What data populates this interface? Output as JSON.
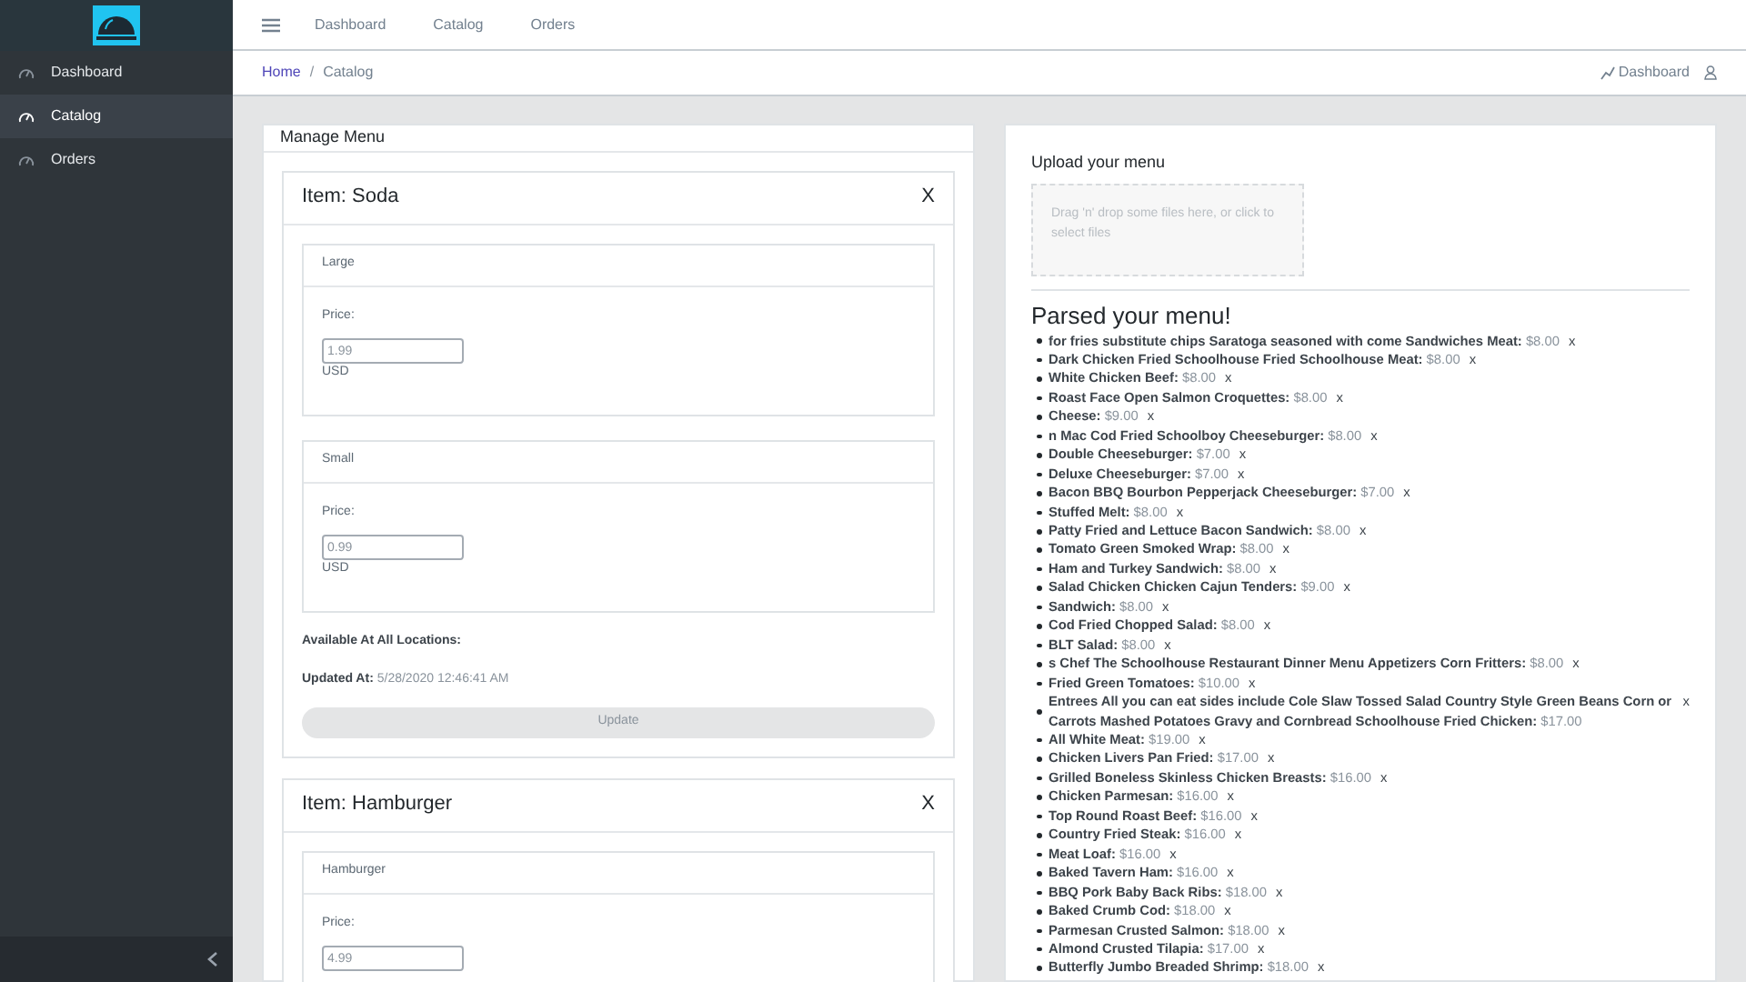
{
  "sidebar": {
    "items": [
      {
        "label": "Dashboard",
        "selected": false
      },
      {
        "label": "Catalog",
        "selected": true
      },
      {
        "label": "Orders",
        "selected": false
      }
    ]
  },
  "top_nav": [
    "Dashboard",
    "Catalog",
    "Orders"
  ],
  "breadcrumb": {
    "items": [
      "Home",
      "Catalog"
    ],
    "separator": "/"
  },
  "header_right": {
    "link": "Dashboard"
  },
  "manage_menu": {
    "title": "Manage Menu",
    "items": [
      {
        "title": "Item: Soda",
        "close": "X",
        "variants": [
          {
            "name": "Large",
            "price_label": "Price:",
            "price": "1.99",
            "currency": "USD"
          },
          {
            "name": "Small",
            "price_label": "Price:",
            "price": "0.99",
            "currency": "USD"
          }
        ],
        "available_label": "Available At All Locations:",
        "updated_label": "Updated At:",
        "updated_value": "5/28/2020 12:46:41 AM",
        "button": "Update"
      },
      {
        "title": "Item: Hamburger",
        "close": "X",
        "variants": [
          {
            "name": "Hamburger",
            "price_label": "Price:",
            "price": "4.99"
          }
        ]
      }
    ]
  },
  "upload": {
    "title": "Upload your menu",
    "dropzone": "Drag 'n' drop some files here, or click to select files"
  },
  "parsed": {
    "title": "Parsed your menu!",
    "items": [
      {
        "name": "for fries substitute chips Saratoga seasoned with come Sandwiches Meat:",
        "price": "$8.00",
        "remove": "x"
      },
      {
        "name": "Dark Chicken Fried Schoolhouse Fried Schoolhouse Meat:",
        "price": "$8.00",
        "remove": "x"
      },
      {
        "name": "White Chicken Beef:",
        "price": "$8.00",
        "remove": "x"
      },
      {
        "name": "Roast Face Open Salmon Croquettes:",
        "price": "$8.00",
        "remove": "x"
      },
      {
        "name": "Cheese:",
        "price": "$9.00",
        "remove": "x"
      },
      {
        "name": "n Mac Cod Fried Schoolboy Cheeseburger:",
        "price": "$8.00",
        "remove": "x"
      },
      {
        "name": "Double Cheeseburger:",
        "price": "$7.00",
        "remove": "x"
      },
      {
        "name": "Deluxe Cheeseburger:",
        "price": "$7.00",
        "remove": "x"
      },
      {
        "name": "Bacon BBQ Bourbon Pepperjack Cheeseburger:",
        "price": "$7.00",
        "remove": "x"
      },
      {
        "name": "Stuffed Melt:",
        "price": "$8.00",
        "remove": "x"
      },
      {
        "name": "Patty Fried and Lettuce Bacon Sandwich:",
        "price": "$8.00",
        "remove": "x"
      },
      {
        "name": "Tomato Green Smoked Wrap:",
        "price": "$8.00",
        "remove": "x"
      },
      {
        "name": "Ham and Turkey Sandwich:",
        "price": "$8.00",
        "remove": "x"
      },
      {
        "name": "Salad Chicken Chicken Cajun Tenders:",
        "price": "$9.00",
        "remove": "x"
      },
      {
        "name": "Sandwich:",
        "price": "$8.00",
        "remove": "x"
      },
      {
        "name": "Cod Fried Chopped Salad:",
        "price": "$8.00",
        "remove": "x"
      },
      {
        "name": "BLT Salad:",
        "price": "$8.00",
        "remove": "x"
      },
      {
        "name": "s Chef The Schoolhouse Restaurant Dinner Menu Appetizers Corn Fritters:",
        "price": "$8.00",
        "remove": "x"
      },
      {
        "name": "Fried Green Tomatoes:",
        "price": "$10.00",
        "remove": "x"
      },
      {
        "name": "Entrees All you can eat sides include Cole Slaw Tossed Salad Country Style Green Beans Corn or Carrots Mashed Potatoes Gravy and Cornbread Schoolhouse Fried Chicken:",
        "price": "$17.00",
        "remove": "x"
      },
      {
        "name": "All White Meat:",
        "price": "$19.00",
        "remove": "x"
      },
      {
        "name": "Chicken Livers Pan Fried:",
        "price": "$17.00",
        "remove": "x"
      },
      {
        "name": "Grilled Boneless Skinless Chicken Breasts:",
        "price": "$16.00",
        "remove": "x"
      },
      {
        "name": "Chicken Parmesan:",
        "price": "$16.00",
        "remove": "x"
      },
      {
        "name": "Top Round Roast Beef:",
        "price": "$16.00",
        "remove": "x"
      },
      {
        "name": "Country Fried Steak:",
        "price": "$16.00",
        "remove": "x"
      },
      {
        "name": "Meat Loaf:",
        "price": "$16.00",
        "remove": "x"
      },
      {
        "name": "Baked Tavern Ham:",
        "price": "$16.00",
        "remove": "x"
      },
      {
        "name": "BBQ Pork Baby Back Ribs:",
        "price": "$18.00",
        "remove": "x"
      },
      {
        "name": "Baked Crumb Cod:",
        "price": "$18.00",
        "remove": "x"
      },
      {
        "name": "Parmesan Crusted Salmon:",
        "price": "$18.00",
        "remove": "x"
      },
      {
        "name": "Almond Crusted Tilapia:",
        "price": "$17.00",
        "remove": "x"
      },
      {
        "name": "Butterfly Jumbo Breaded Shrimp:",
        "price": "$18.00",
        "remove": "x"
      }
    ]
  }
}
